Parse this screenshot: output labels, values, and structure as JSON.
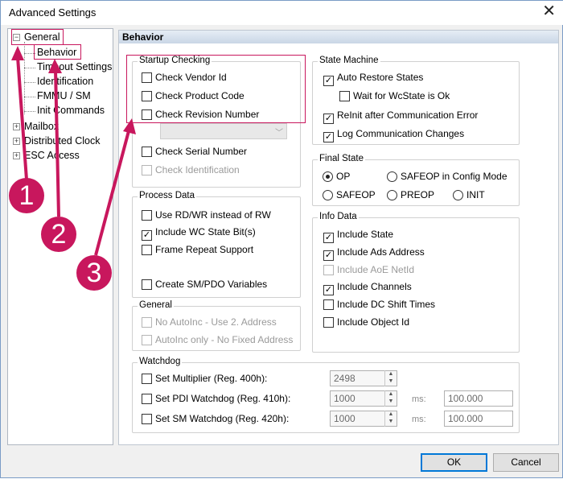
{
  "window": {
    "title": "Advanced Settings",
    "close_glyph": "✕"
  },
  "tree": {
    "general": "General",
    "children": [
      "Behavior",
      "Timeout Settings",
      "Identification",
      "FMMU / SM",
      "Init Commands"
    ],
    "mailbox": "Mailbox",
    "distributed_clock": "Distributed Clock",
    "esc_access": "ESC Access"
  },
  "panel": {
    "title": "Behavior"
  },
  "startup": {
    "label": "Startup Checking",
    "vendor_id": {
      "label": "Check Vendor Id",
      "checked": false
    },
    "product_code": {
      "label": "Check Product Code",
      "checked": false
    },
    "revision": {
      "label": "Check Revision Number",
      "checked": false
    },
    "serial": {
      "label": "Check Serial Number",
      "checked": false
    },
    "identification": {
      "label": "Check Identification",
      "checked": false
    }
  },
  "process_data": {
    "label": "Process Data",
    "rdwr": {
      "label": "Use RD/WR instead of RW",
      "checked": false
    },
    "wc_state": {
      "label": "Include WC State Bit(s)",
      "checked": true
    },
    "frame_repeat": {
      "label": "Frame Repeat Support",
      "checked": false
    },
    "create_sm": {
      "label": "Create SM/PDO Variables",
      "checked": false
    }
  },
  "general_group": {
    "label": "General",
    "no_autoinc": {
      "label": "No AutoInc - Use 2. Address",
      "checked": false
    },
    "autoinc_only": {
      "label": "AutoInc only - No Fixed Address",
      "checked": false
    }
  },
  "state_machine": {
    "label": "State Machine",
    "auto_restore": {
      "label": "Auto Restore States",
      "checked": true
    },
    "wait_wc": {
      "label": "Wait for WcState is Ok",
      "checked": false
    },
    "reinit": {
      "label": "ReInit after Communication Error",
      "checked": true
    },
    "log_changes": {
      "label": "Log Communication Changes",
      "checked": true
    }
  },
  "final_state": {
    "label": "Final State",
    "options": [
      "OP",
      "SAFEOP in Config Mode",
      "SAFEOP",
      "PREOP",
      "INIT"
    ],
    "selected": "OP"
  },
  "info_data": {
    "label": "Info Data",
    "state": {
      "label": "Include State",
      "checked": true
    },
    "ads": {
      "label": "Include Ads Address",
      "checked": true
    },
    "aoe": {
      "label": "Include AoE NetId",
      "checked": false
    },
    "channels": {
      "label": "Include Channels",
      "checked": true
    },
    "dc_shift": {
      "label": "Include DC Shift Times",
      "checked": false
    },
    "object_id": {
      "label": "Include Object Id",
      "checked": false
    }
  },
  "watchdog": {
    "label": "Watchdog",
    "multiplier": {
      "label": "Set Multiplier (Reg. 400h):",
      "checked": false,
      "value": "2498"
    },
    "pdi": {
      "label": "Set PDI Watchdog (Reg. 410h):",
      "checked": false,
      "value": "1000",
      "unit": "ms:",
      "time": "100.000"
    },
    "sm": {
      "label": "Set SM Watchdog (Reg. 420h):",
      "checked": false,
      "value": "1000",
      "unit": "ms:",
      "time": "100.000"
    }
  },
  "buttons": {
    "ok": "OK",
    "cancel": "Cancel"
  },
  "annotations": {
    "badge1": "1",
    "badge2": "2",
    "badge3": "3",
    "accent_color": "#c8175d"
  }
}
